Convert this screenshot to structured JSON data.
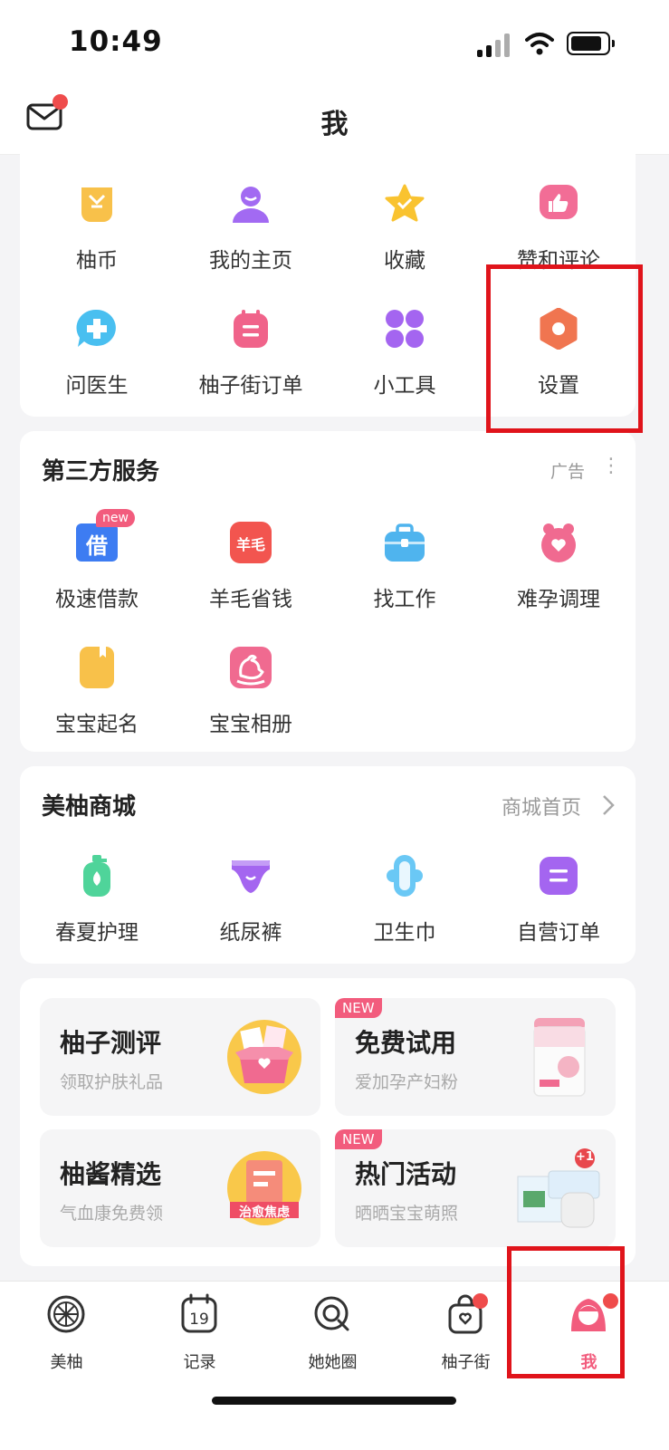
{
  "status_bar": {
    "time": "10:49"
  },
  "header": {
    "title": "我"
  },
  "profile_menu": [
    {
      "label": "柚币",
      "icon": "coin-icon"
    },
    {
      "label": "我的主页",
      "icon": "user-icon"
    },
    {
      "label": "收藏",
      "icon": "star-icon"
    },
    {
      "label": "赞和评论",
      "icon": "thumbs-up-icon"
    },
    {
      "label": "问医生",
      "icon": "doctor-chat-icon"
    },
    {
      "label": "柚子街订单",
      "icon": "order-icon"
    },
    {
      "label": "小工具",
      "icon": "tools-icon"
    },
    {
      "label": "设置",
      "icon": "settings-icon"
    }
  ],
  "third_party": {
    "title": "第三方服务",
    "ad_label": "广告",
    "new_badge": "new",
    "loan_icon_text": "借",
    "wool_icon_text": "羊毛",
    "items": [
      {
        "label": "极速借款",
        "icon": "loan-icon"
      },
      {
        "label": "羊毛省钱",
        "icon": "wool-icon"
      },
      {
        "label": "找工作",
        "icon": "briefcase-icon"
      },
      {
        "label": "难孕调理",
        "icon": "fertility-icon"
      },
      {
        "label": "宝宝起名",
        "icon": "naming-icon"
      },
      {
        "label": "宝宝相册",
        "icon": "album-icon"
      }
    ]
  },
  "mall": {
    "title": "美柚商城",
    "link": "商城首页",
    "items": [
      {
        "label": "春夏护理",
        "icon": "lotion-icon"
      },
      {
        "label": "纸尿裤",
        "icon": "diaper-icon"
      },
      {
        "label": "卫生巾",
        "icon": "pad-icon"
      },
      {
        "label": "自营订单",
        "icon": "self-order-icon"
      }
    ]
  },
  "promos": [
    {
      "title": "柚子测评",
      "subtitle": "领取护肤礼品",
      "badge": ""
    },
    {
      "title": "免费试用",
      "subtitle": "爱加孕产妇粉",
      "badge": "NEW"
    },
    {
      "title": "柚酱精选",
      "subtitle": "气血康免费领",
      "badge": "",
      "img_text": "治愈焦虑"
    },
    {
      "title": "热门活动",
      "subtitle": "晒晒宝宝萌照",
      "badge": "NEW",
      "img_text": "+1"
    }
  ],
  "tabbar": [
    {
      "label": "美柚",
      "icon": "meiyou-icon",
      "active": false
    },
    {
      "label": "记录",
      "icon": "calendar-icon",
      "active": false
    },
    {
      "label": "她她圈",
      "icon": "community-icon",
      "active": false
    },
    {
      "label": "柚子街",
      "icon": "shopping-bag-icon",
      "active": false
    },
    {
      "label": "我",
      "icon": "profile-icon",
      "active": true
    }
  ],
  "calendar_day": "19",
  "colors": {
    "accent": "#f25c7d",
    "notification": "#ef4c4c",
    "annotation": "#e0141b"
  }
}
